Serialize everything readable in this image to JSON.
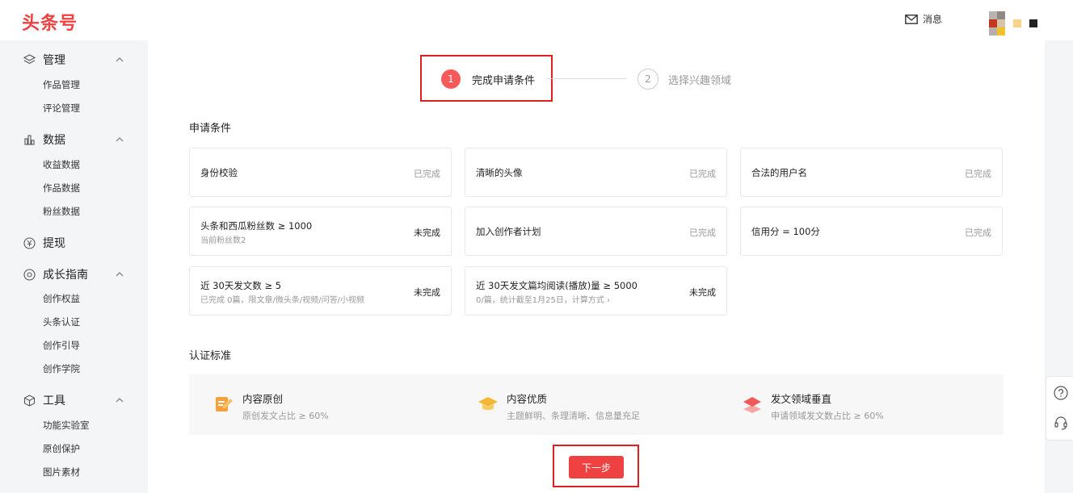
{
  "header": {
    "logo": "头条号",
    "messages_label": "消息"
  },
  "sidebar": {
    "groups": [
      {
        "label": "管理",
        "icon": "layers-icon",
        "items": [
          "作品管理",
          "评论管理"
        ]
      },
      {
        "label": "数据",
        "icon": "bar-chart-icon",
        "items": [
          "收益数据",
          "作品数据",
          "粉丝数据"
        ]
      },
      {
        "label": "提现",
        "icon": "yen-icon",
        "items": []
      },
      {
        "label": "成长指南",
        "icon": "growth-icon",
        "items": [
          "创作权益",
          "头条认证",
          "创作引导",
          "创作学院"
        ]
      },
      {
        "label": "工具",
        "icon": "cube-icon",
        "items": [
          "功能实验室",
          "原创保护",
          "图片素材"
        ]
      }
    ]
  },
  "steps": [
    {
      "num": "1",
      "label": "完成申请条件"
    },
    {
      "num": "2",
      "label": "选择兴趣领域"
    }
  ],
  "conditions": {
    "title": "申请条件",
    "cards": [
      {
        "title": "身份校验",
        "sub": "",
        "status": "已完成"
      },
      {
        "title": "清晰的头像",
        "sub": "",
        "status": "已完成"
      },
      {
        "title": "合法的用户名",
        "sub": "",
        "status": "已完成"
      },
      {
        "title": "头条和西瓜粉丝数 ≥ 1000",
        "sub": "当前粉丝数2",
        "status": "未完成"
      },
      {
        "title": "加入创作者计划",
        "sub": "",
        "status": "已完成"
      },
      {
        "title": "信用分 = 100分",
        "sub": "",
        "status": "已完成"
      },
      {
        "title": "近 30天发文数 ≥ 5",
        "sub": "已完成 0篇，限文章/微头条/视频/问答/小视频",
        "status": "未完成"
      },
      {
        "title": "近 30天发文篇均阅读(播放)量 ≥ 5000",
        "sub": "0/篇，统计截至1月25日，计算方式 ›",
        "status": "未完成"
      }
    ]
  },
  "standards": {
    "title": "认证标准",
    "items": [
      {
        "title": "内容原创",
        "desc": "原创发文占比 ≥ 60%",
        "icon": "edit-icon"
      },
      {
        "title": "内容优质",
        "desc": "主题鲜明、条理清晰、信息量充足",
        "icon": "graduation-cap-icon"
      },
      {
        "title": "发文领域垂直",
        "desc": "申请领域发文数占比 ≥ 60%",
        "icon": "stack-icon"
      }
    ]
  },
  "next_button": "下一步",
  "colors": {
    "brand": "#f04142",
    "step_active": "#f85959",
    "highlight_box": "#e02020"
  }
}
